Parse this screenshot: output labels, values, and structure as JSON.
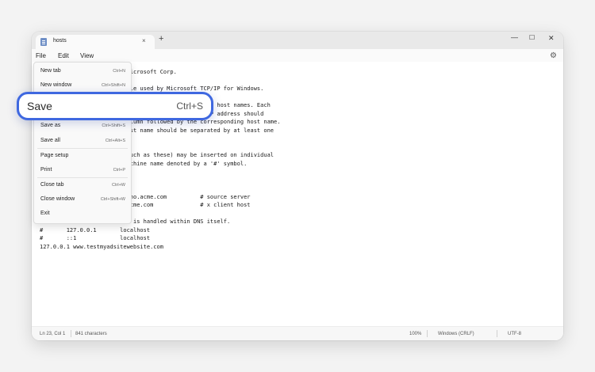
{
  "window": {
    "tab_title": "hosts",
    "tab_close_glyph": "×",
    "new_tab_glyph": "+",
    "minimize_glyph": "—",
    "maximize_glyph": "☐",
    "close_glyph": "✕"
  },
  "menubar": {
    "file": "File",
    "edit": "Edit",
    "view": "View",
    "settings_glyph": "⚙"
  },
  "editor": {
    "text": "# Copyright (c) 1993-2009 Microsoft Corp.\n#\n# This is a sample HOSTS file used by Microsoft TCP/IP for Windows.\n#\n# This file contains the mappings of IP addresses to host names. Each\n# entry should be kept on an individual line. The IP address should\n# be placed in the first column followed by the corresponding host name.\n# The IP address and the host name should be separated by at least one\n# space.\n#\n# Additionally, comments (such as these) may be inserted on individual\n# lines or following the machine name denoted by a '#' symbol.\n#\n# For example:\n#\n#      102.54.94.97     rhino.acme.com          # source server\n#       38.25.63.10     x.acme.com              # x client host\n\n# localhost name resolution is handled within DNS itself.\n#\t127.0.0.1       localhost\n#\t::1             localhost\n127.0.0.1 www.testmyadsitewebsite.com"
  },
  "file_menu": {
    "items": [
      {
        "label": "New tab",
        "shortcut": "Ctrl+N"
      },
      {
        "label": "New window",
        "shortcut": "Ctrl+Shift+N"
      },
      {
        "label": "Save as",
        "shortcut": "Ctrl+Shift+S"
      },
      {
        "label": "Save all",
        "shortcut": "Ctrl+Alt+S"
      },
      {
        "label": "Page setup",
        "shortcut": ""
      },
      {
        "label": "Print",
        "shortcut": "Ctrl+P"
      },
      {
        "label": "Close tab",
        "shortcut": "Ctrl+W"
      },
      {
        "label": "Close window",
        "shortcut": "Ctrl+Shift+W"
      },
      {
        "label": "Exit",
        "shortcut": ""
      }
    ]
  },
  "save_callout": {
    "label": "Save",
    "shortcut": "Ctrl+S",
    "accent_color": "#3f68e0"
  },
  "status": {
    "position": "Ln 23, Col 1",
    "characters": "841 characters",
    "zoom": "100%",
    "line_ending": "Windows (CRLF)",
    "encoding": "UTF-8"
  }
}
